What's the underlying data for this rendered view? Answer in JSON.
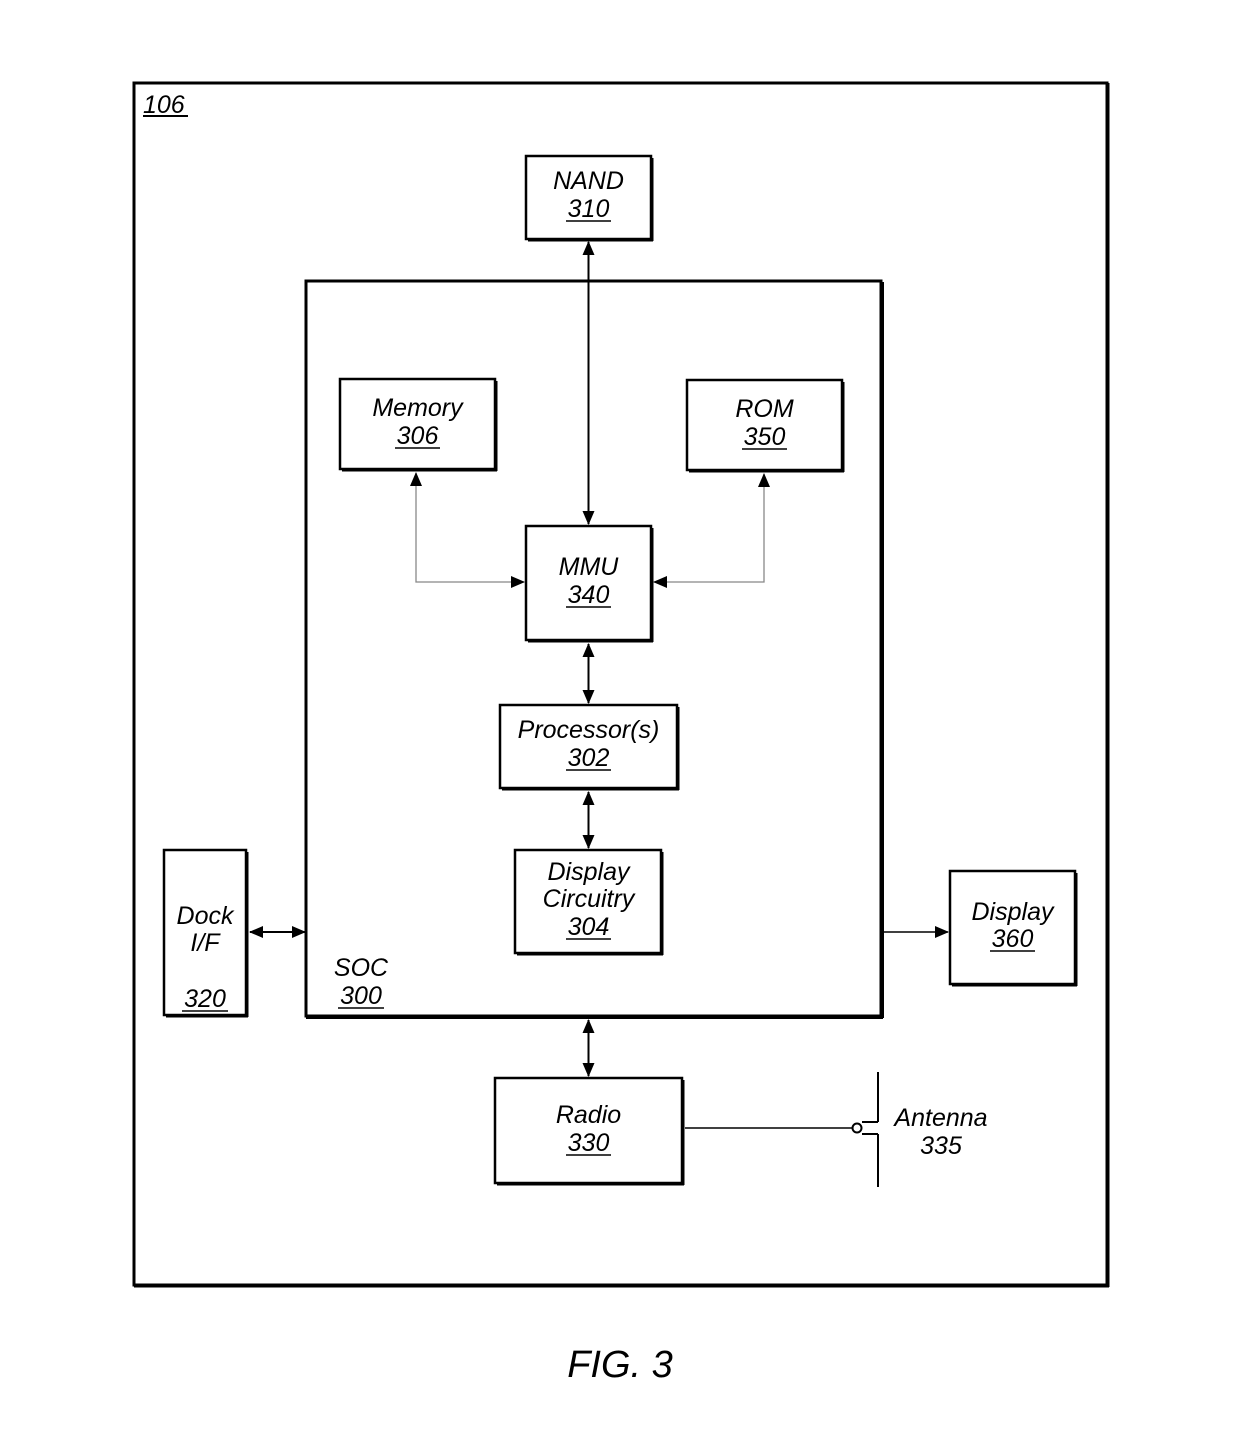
{
  "figure": {
    "caption": "FIG. 3",
    "device_ref": "106"
  },
  "blocks": {
    "nand": {
      "name": "NAND",
      "ref": "310"
    },
    "soc": {
      "name": "SOC",
      "ref": "300"
    },
    "memory": {
      "name": "Memory",
      "ref": "306"
    },
    "rom": {
      "name": "ROM",
      "ref": "350"
    },
    "mmu": {
      "name": "MMU",
      "ref": "340"
    },
    "processor": {
      "name": "Processor(s)",
      "ref": "302"
    },
    "display_circuitry": {
      "name_line1": "Display",
      "name_line2": "Circuitry",
      "ref": "304"
    },
    "dock": {
      "name_line1": "Dock",
      "name_line2": "I/F",
      "ref": "320"
    },
    "display": {
      "name": "Display",
      "ref": "360"
    },
    "radio": {
      "name": "Radio",
      "ref": "330"
    },
    "antenna": {
      "name": "Antenna",
      "ref": "335"
    }
  },
  "connections": [
    {
      "from": "nand",
      "to": "mmu",
      "type": "bidirectional"
    },
    {
      "from": "memory",
      "to": "mmu",
      "type": "bidirectional"
    },
    {
      "from": "rom",
      "to": "mmu",
      "type": "bidirectional"
    },
    {
      "from": "mmu",
      "to": "processor",
      "type": "bidirectional"
    },
    {
      "from": "processor",
      "to": "display_circuitry",
      "type": "bidirectional"
    },
    {
      "from": "dock",
      "to": "soc",
      "type": "bidirectional"
    },
    {
      "from": "soc",
      "to": "display",
      "type": "unidirectional"
    },
    {
      "from": "soc",
      "to": "radio",
      "type": "bidirectional"
    },
    {
      "from": "radio",
      "to": "antenna",
      "type": "line"
    }
  ]
}
